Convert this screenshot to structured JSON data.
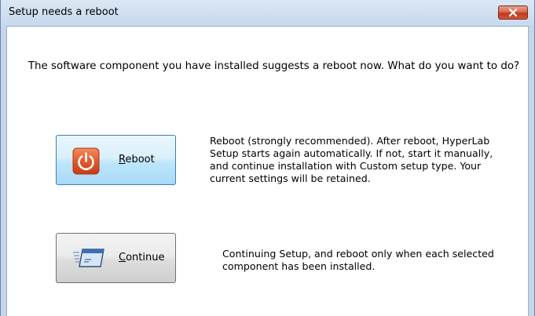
{
  "window": {
    "title": "Setup needs a reboot",
    "close_icon": "close-icon"
  },
  "prompt": "The software component you have installed suggests a reboot now. What do you want to do?",
  "reboot": {
    "label_first": "R",
    "label_rest": "eboot",
    "icon": "power-icon",
    "description": [
      "Reboot (strongly recommended). After reboot, HyperLab",
      "Setup starts again automatically. If not, start it manually,",
      "and continue installation with Custom setup type. Your",
      "current settings will be retained."
    ]
  },
  "continue": {
    "label_first": "C",
    "label_rest": "ontinue",
    "icon": "fast-window-icon",
    "description": [
      "Continuing Setup, and reboot only when each selected",
      "component has been installed."
    ]
  },
  "colors": {
    "titlebar": "#c7d9ec",
    "close_button": "#c2391c",
    "reboot_icon": "#e25a2c",
    "reboot_button_border": "#3c7fb1"
  }
}
